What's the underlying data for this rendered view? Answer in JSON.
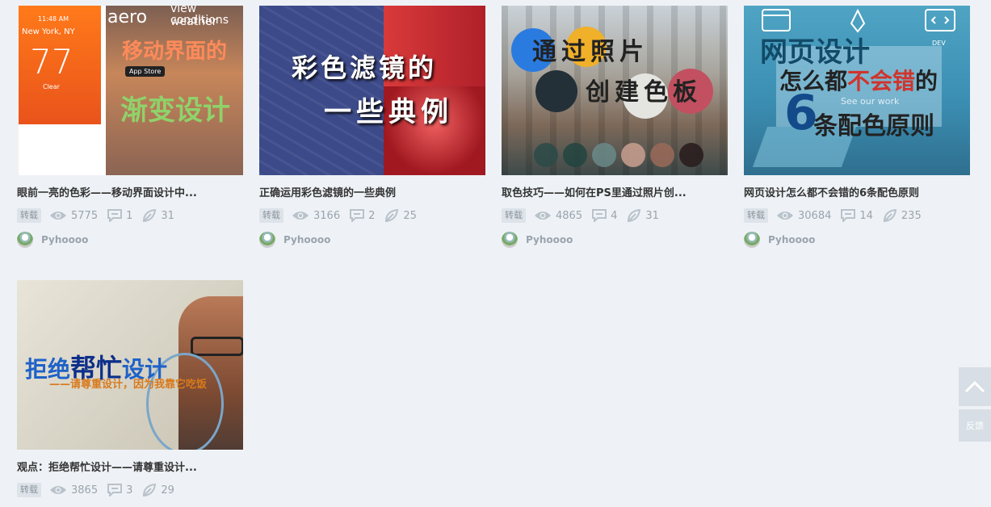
{
  "cards": [
    {
      "title": "眼前一亮的色彩——移动界面设计中...",
      "tag": "转载",
      "views": "5775",
      "comments": "1",
      "likes": "31",
      "author": "Pyhoooo",
      "thumb_text": {
        "time": "11:48 AM",
        "city": "New York, NY",
        "temp": "77",
        "cond": "Clear",
        "app": "aero",
        "line1": "view weather",
        "line2": "conditions",
        "big1": "移动界面的",
        "store": "App Store",
        "big2": "渐变设计"
      }
    },
    {
      "title": "正确运用彩色滤镜的一些典例",
      "tag": "转载",
      "views": "3166",
      "comments": "2",
      "likes": "25",
      "author": "Pyhoooo",
      "thumb_text": {
        "line1": "彩色滤镜的",
        "line2": "一些典例"
      }
    },
    {
      "title": "取色技巧——如何在PS里通过照片创...",
      "tag": "转载",
      "views": "4865",
      "comments": "4",
      "likes": "31",
      "author": "Pyhoooo",
      "thumb_text": {
        "line1": "通过照片",
        "line2": "创建色板"
      }
    },
    {
      "title": "网页设计怎么都不会错的6条配色原则",
      "tag": "转载",
      "views": "30684",
      "comments": "14",
      "likes": "235",
      "author": "Pyhoooo",
      "thumb_text": {
        "line1": "网页设计",
        "line2a": "怎么都",
        "line2b": "不会错",
        "line2c": "的",
        "num": "6",
        "line3": "条配色原则",
        "seeour": "See our work",
        "dev": "DEV"
      }
    },
    {
      "title": "观点：拒绝帮忙设计——请尊重设计...",
      "tag": "转载",
      "views": "3865",
      "comments": "3",
      "likes": "29",
      "thumb_text": {
        "line1a": "拒绝",
        "line1b": "帮忙",
        "line1c": "设计",
        "line2": "——请尊重设计，因为我靠它吃饭"
      }
    }
  ],
  "side": {
    "feedback": "反馈"
  },
  "colors": {
    "background": "#eef2f6",
    "tag_bg": "#dde3e9",
    "meta": "#9aa4ad"
  }
}
